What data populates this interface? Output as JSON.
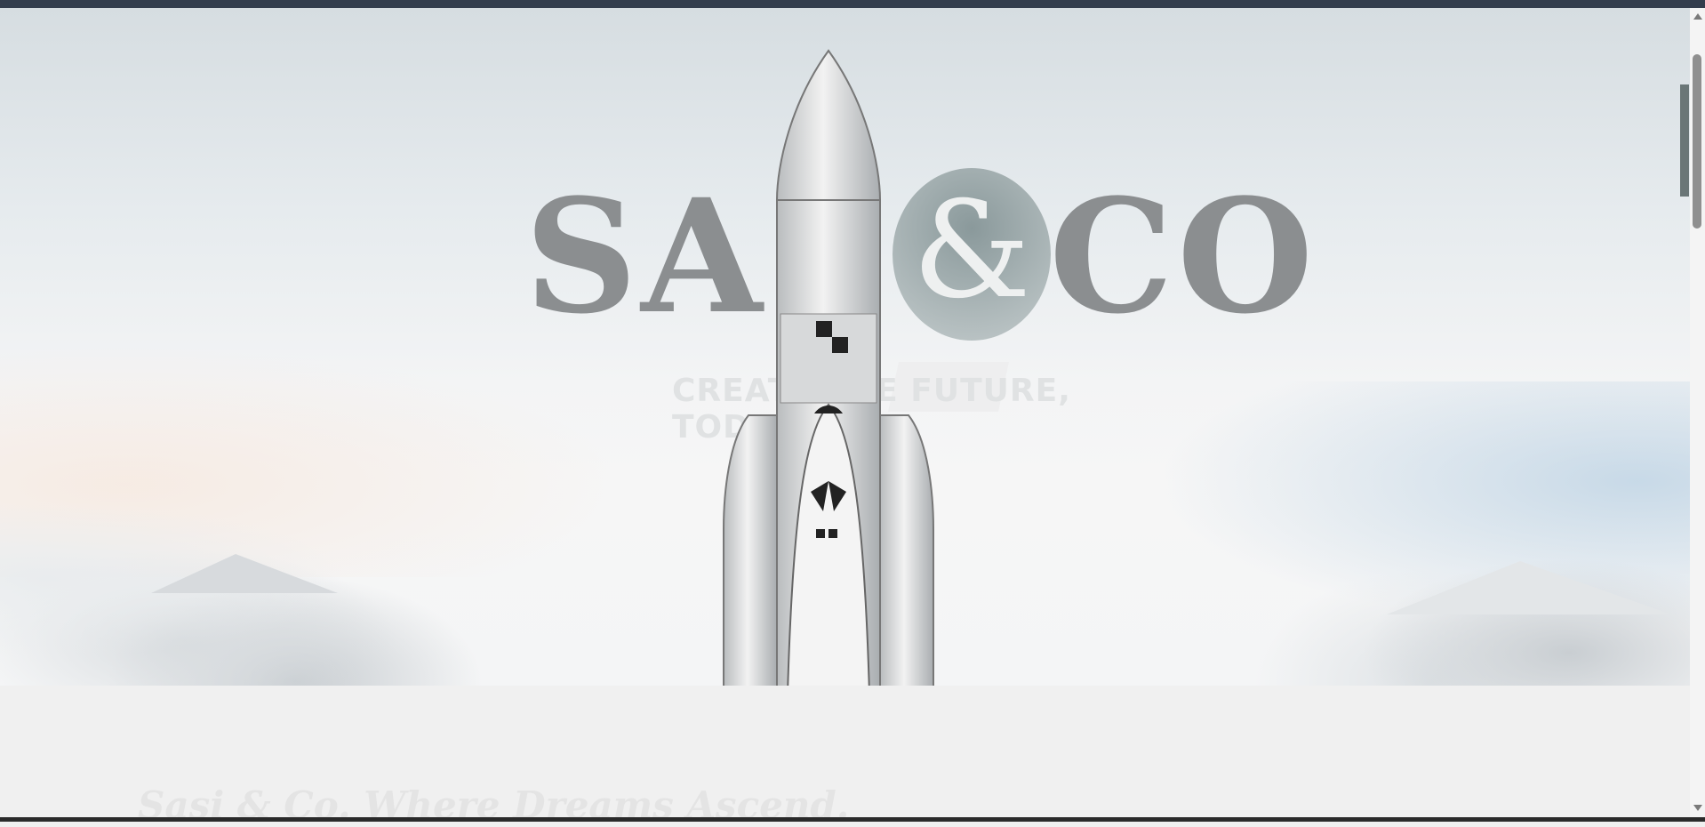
{
  "hero": {
    "logo_left": "SAS",
    "logo_amp": "&",
    "logo_right": "CO",
    "tagline": "CREATE THE FUTURE, TODAY"
  },
  "section": {
    "title": "Sasi & Co. Where Dreams Ascend."
  },
  "colors": {
    "top_bar": "#333d4d",
    "logo_text": "#8b8e90",
    "amp_circle": "#8a999b",
    "page_background": "#f0f0f0"
  },
  "icons": {
    "scroll_up": "triangle-up",
    "scroll_down": "triangle-down"
  }
}
